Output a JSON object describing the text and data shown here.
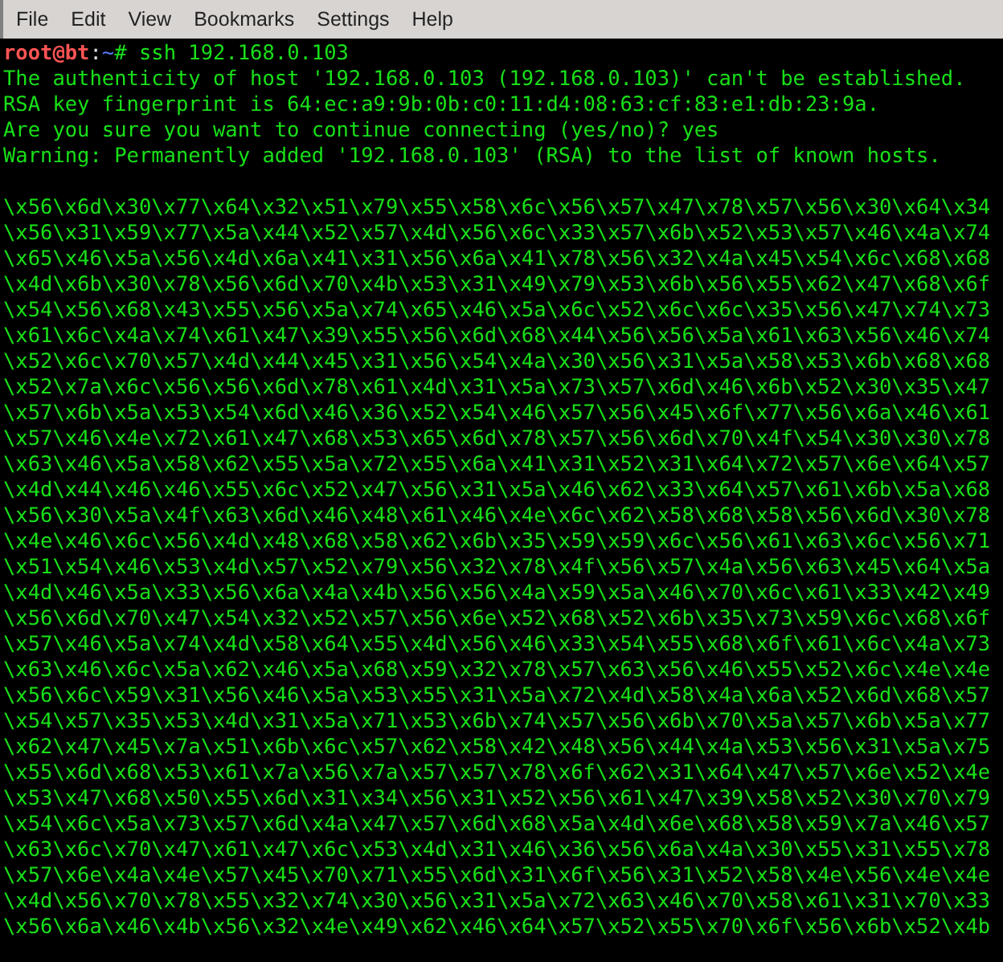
{
  "menu": [
    "File",
    "Edit",
    "View",
    "Bookmarks",
    "Settings",
    "Help"
  ],
  "terminal": {
    "prompt": [
      {
        "kind": "user",
        "text": "root@bt"
      },
      {
        "kind": "sep",
        "text": ":"
      },
      {
        "kind": "path",
        "text": "~"
      },
      {
        "kind": "cmd",
        "text": "# ssh 192.168.0.103"
      }
    ],
    "output": [
      "The authenticity of host '192.168.0.103 (192.168.0.103)' can't be established.",
      "RSA key fingerprint is 64:ec:a9:9b:0b:c0:11:d4:08:63:cf:83:e1:db:23:9a.",
      "Are you sure you want to continue connecting (yes/no)? yes",
      "Warning: Permanently added '192.168.0.103' (RSA) to the list of known hosts."
    ],
    "data": [
      "\\x56\\x6d\\x30\\x77\\x64\\x32\\x51\\x79\\x55\\x58\\x6c\\x56\\x57\\x47\\x78\\x57\\x56\\x30\\x64\\x34",
      "\\x56\\x31\\x59\\x77\\x5a\\x44\\x52\\x57\\x4d\\x56\\x6c\\x33\\x57\\x6b\\x52\\x53\\x57\\x46\\x4a\\x74",
      "\\x65\\x46\\x5a\\x56\\x4d\\x6a\\x41\\x31\\x56\\x6a\\x41\\x78\\x56\\x32\\x4a\\x45\\x54\\x6c\\x68\\x68",
      "\\x4d\\x6b\\x30\\x78\\x56\\x6d\\x70\\x4b\\x53\\x31\\x49\\x79\\x53\\x6b\\x56\\x55\\x62\\x47\\x68\\x6f",
      "\\x54\\x56\\x68\\x43\\x55\\x56\\x5a\\x74\\x65\\x46\\x5a\\x6c\\x52\\x6c\\x6c\\x35\\x56\\x47\\x74\\x73",
      "\\x61\\x6c\\x4a\\x74\\x61\\x47\\x39\\x55\\x56\\x6d\\x68\\x44\\x56\\x56\\x5a\\x61\\x63\\x56\\x46\\x74",
      "\\x52\\x6c\\x70\\x57\\x4d\\x44\\x45\\x31\\x56\\x54\\x4a\\x30\\x56\\x31\\x5a\\x58\\x53\\x6b\\x68\\x68",
      "\\x52\\x7a\\x6c\\x56\\x56\\x6d\\x78\\x61\\x4d\\x31\\x5a\\x73\\x57\\x6d\\x46\\x6b\\x52\\x30\\x35\\x47",
      "\\x57\\x6b\\x5a\\x53\\x54\\x6d\\x46\\x36\\x52\\x54\\x46\\x57\\x56\\x45\\x6f\\x77\\x56\\x6a\\x46\\x61",
      "\\x57\\x46\\x4e\\x72\\x61\\x47\\x68\\x53\\x65\\x6d\\x78\\x57\\x56\\x6d\\x70\\x4f\\x54\\x30\\x30\\x78",
      "\\x63\\x46\\x5a\\x58\\x62\\x55\\x5a\\x72\\x55\\x6a\\x41\\x31\\x52\\x31\\x64\\x72\\x57\\x6e\\x64\\x57",
      "\\x4d\\x44\\x46\\x46\\x55\\x6c\\x52\\x47\\x56\\x31\\x5a\\x46\\x62\\x33\\x64\\x57\\x61\\x6b\\x5a\\x68",
      "\\x56\\x30\\x5a\\x4f\\x63\\x6d\\x46\\x48\\x61\\x46\\x4e\\x6c\\x62\\x58\\x68\\x58\\x56\\x6d\\x30\\x78",
      "\\x4e\\x46\\x6c\\x56\\x4d\\x48\\x68\\x58\\x62\\x6b\\x35\\x59\\x59\\x6c\\x56\\x61\\x63\\x6c\\x56\\x71",
      "\\x51\\x54\\x46\\x53\\x4d\\x57\\x52\\x79\\x56\\x32\\x78\\x4f\\x56\\x57\\x4a\\x56\\x63\\x45\\x64\\x5a",
      "\\x4d\\x46\\x5a\\x33\\x56\\x6a\\x4a\\x4b\\x56\\x56\\x4a\\x59\\x5a\\x46\\x70\\x6c\\x61\\x33\\x42\\x49",
      "\\x56\\x6d\\x70\\x47\\x54\\x32\\x52\\x57\\x56\\x6e\\x52\\x68\\x52\\x6b\\x35\\x73\\x59\\x6c\\x68\\x6f",
      "\\x57\\x46\\x5a\\x74\\x4d\\x58\\x64\\x55\\x4d\\x56\\x46\\x33\\x54\\x55\\x68\\x6f\\x61\\x6c\\x4a\\x73",
      "\\x63\\x46\\x6c\\x5a\\x62\\x46\\x5a\\x68\\x59\\x32\\x78\\x57\\x63\\x56\\x46\\x55\\x52\\x6c\\x4e\\x4e",
      "\\x56\\x6c\\x59\\x31\\x56\\x46\\x5a\\x53\\x55\\x31\\x5a\\x72\\x4d\\x58\\x4a\\x6a\\x52\\x6d\\x68\\x57",
      "\\x54\\x57\\x35\\x53\\x4d\\x31\\x5a\\x71\\x53\\x6b\\x74\\x57\\x56\\x6b\\x70\\x5a\\x57\\x6b\\x5a\\x77",
      "\\x62\\x47\\x45\\x7a\\x51\\x6b\\x6c\\x57\\x62\\x58\\x42\\x48\\x56\\x44\\x4a\\x53\\x56\\x31\\x5a\\x75",
      "\\x55\\x6d\\x68\\x53\\x61\\x7a\\x56\\x7a\\x57\\x57\\x78\\x6f\\x62\\x31\\x64\\x47\\x57\\x6e\\x52\\x4e",
      "\\x53\\x47\\x68\\x50\\x55\\x6d\\x31\\x34\\x56\\x31\\x52\\x56\\x61\\x47\\x39\\x58\\x52\\x30\\x70\\x79",
      "\\x54\\x6c\\x5a\\x73\\x57\\x6d\\x4a\\x47\\x57\\x6d\\x68\\x5a\\x4d\\x6e\\x68\\x58\\x59\\x7a\\x46\\x57",
      "\\x63\\x6c\\x70\\x47\\x61\\x47\\x6c\\x53\\x4d\\x31\\x46\\x36\\x56\\x6a\\x4a\\x30\\x55\\x31\\x55\\x78",
      "\\x57\\x6e\\x4a\\x4e\\x57\\x45\\x70\\x71\\x55\\x6d\\x31\\x6f\\x56\\x31\\x52\\x58\\x4e\\x56\\x4e\\x4e",
      "\\x4d\\x56\\x70\\x78\\x55\\x32\\x74\\x30\\x56\\x31\\x5a\\x72\\x63\\x46\\x70\\x58\\x61\\x31\\x70\\x33",
      "\\x56\\x6a\\x46\\x4b\\x56\\x32\\x4e\\x49\\x62\\x46\\x64\\x57\\x52\\x55\\x70\\x6f\\x56\\x6b\\x52\\x4b"
    ]
  }
}
